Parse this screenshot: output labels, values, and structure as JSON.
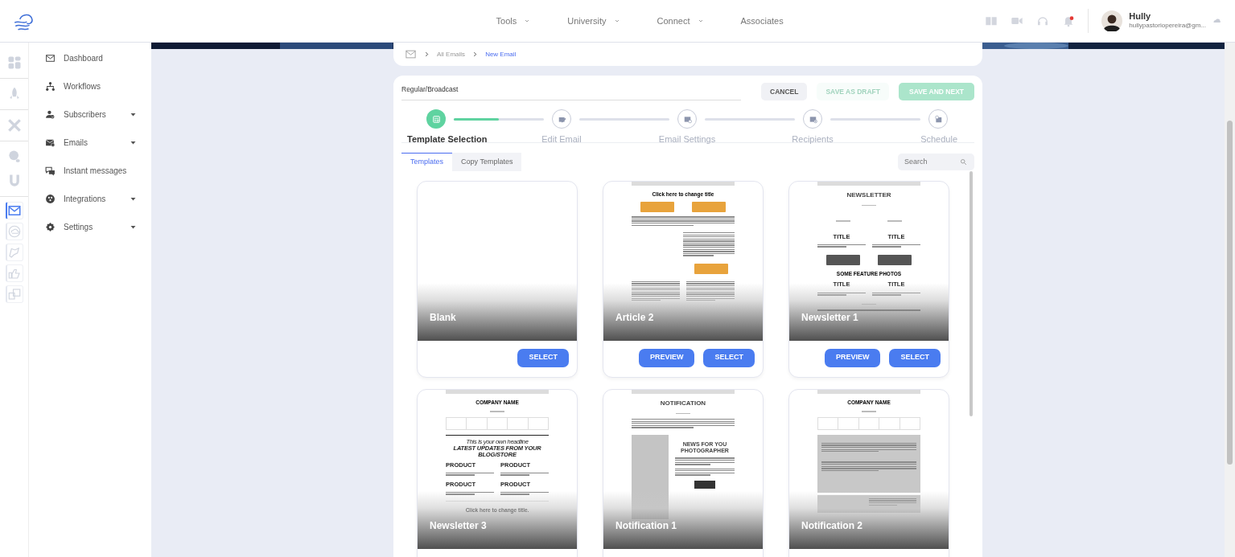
{
  "top_nav": [
    {
      "label": "Tools",
      "dropdown": true
    },
    {
      "label": "University",
      "dropdown": true
    },
    {
      "label": "Connect",
      "dropdown": true
    },
    {
      "label": "Associates",
      "dropdown": false
    }
  ],
  "user": {
    "name": "Hully",
    "email": "hullypastoriopereira@gm...",
    "unread": true
  },
  "rail_groups": [
    {
      "items": [
        {
          "selected": false
        }
      ]
    },
    {
      "items": [
        {
          "selected": false
        }
      ]
    },
    {
      "items": [
        {
          "selected": false
        }
      ]
    },
    {
      "items": [
        {
          "selected": false
        },
        {
          "selected": false
        }
      ]
    },
    {
      "items": [
        {
          "selected": true
        },
        {
          "selected": false
        },
        {
          "selected": false
        },
        {
          "selected": false
        },
        {
          "selected": false
        }
      ]
    }
  ],
  "sidebar": [
    {
      "label": "Dashboard",
      "expandable": false
    },
    {
      "label": "Workflows",
      "expandable": false
    },
    {
      "label": "Subscribers",
      "expandable": true
    },
    {
      "label": "Emails",
      "expandable": true
    },
    {
      "label": "Instant messages",
      "expandable": false
    },
    {
      "label": "Integrations",
      "expandable": true
    },
    {
      "label": "Settings",
      "expandable": true
    }
  ],
  "breadcrumb": [
    {
      "label": "All Emails",
      "current": false
    },
    {
      "label": "New Email",
      "current": true
    }
  ],
  "email_name": {
    "value": "Regular/Broadcast"
  },
  "actions": [
    {
      "label": "CANCEL",
      "kind": "secondary",
      "disabled": false
    },
    {
      "label": "SAVE AS DRAFT",
      "kind": "outline",
      "disabled": true
    },
    {
      "label": "SAVE AND NEXT",
      "kind": "primary",
      "disabled": true
    }
  ],
  "steps": [
    {
      "label": "Template Selection",
      "selected": true,
      "level": 0.5
    },
    {
      "label": "Edit Email",
      "selected": false
    },
    {
      "label": "Email Settings",
      "selected": false
    },
    {
      "label": "Recipients",
      "selected": false
    },
    {
      "label": "Schedule",
      "selected": false
    }
  ],
  "tabs": [
    {
      "label": "Templates",
      "selected": true
    },
    {
      "label": "Copy Templates",
      "selected": false
    }
  ],
  "search": {
    "placeholder": "Search"
  },
  "templates": [
    {
      "name": "Blank",
      "buttons": [
        "SELECT"
      ]
    },
    {
      "name": "Article 2",
      "buttons": [
        "PREVIEW",
        "SELECT"
      ],
      "preview": [
        {
          "kind": "bar"
        },
        {
          "kind": "title",
          "text": "Click here to change title"
        },
        {
          "kind": "button-pair",
          "color": "#e8a33c"
        },
        {
          "kind": "paragraph"
        },
        {
          "kind": "split-paragraph"
        },
        {
          "kind": "button-right",
          "color": "#e8a33c"
        },
        {
          "kind": "two-col-paragraph"
        }
      ]
    },
    {
      "name": "Newsletter 1",
      "buttons": [
        "PREVIEW",
        "SELECT"
      ],
      "preview": [
        {
          "kind": "bar"
        },
        {
          "kind": "masthead",
          "text": "NEWSLETTER"
        },
        {
          "kind": "tagline"
        },
        {
          "kind": "tagline-pair"
        },
        {
          "kind": "label-pair",
          "labels": [
            "TITLE",
            "TITLE"
          ]
        },
        {
          "kind": "button-pair",
          "color": "#555555"
        },
        {
          "kind": "title",
          "text": "SOME FEATURE PHOTOS"
        },
        {
          "kind": "label-pair",
          "labels": [
            "TITLE",
            "TITLE"
          ]
        },
        {
          "kind": "tagline"
        },
        {
          "kind": "dark-block"
        }
      ]
    },
    {
      "name": "Newsletter 3",
      "preview": [
        {
          "kind": "bar"
        },
        {
          "kind": "title",
          "text": "COMPANY NAME"
        },
        {
          "kind": "tagline"
        },
        {
          "kind": "nav-cells"
        },
        {
          "kind": "headline",
          "texts": [
            "This is your own headline",
            "LATEST UPDATES FROM YOUR BLOG/STORE"
          ]
        },
        {
          "kind": "label-pair-left",
          "labels": [
            "PRODUCT",
            "PRODUCT"
          ]
        },
        {
          "kind": "label-pair-left",
          "labels": [
            "PRODUCT",
            "PRODUCT"
          ]
        },
        {
          "kind": "rule"
        },
        {
          "kind": "title",
          "text": "Click here to change title."
        },
        {
          "kind": "tagline"
        }
      ]
    },
    {
      "name": "Notification 1",
      "preview": [
        {
          "kind": "bar"
        },
        {
          "kind": "masthead",
          "text": "NOTIFICATION"
        },
        {
          "kind": "tagline"
        },
        {
          "kind": "paragraph"
        },
        {
          "kind": "feature",
          "text": "NEWS FOR YOU PHOTOGRAPHER"
        }
      ]
    },
    {
      "name": "Notification 2",
      "preview": [
        {
          "kind": "bar"
        },
        {
          "kind": "title",
          "text": "COMPANY NAME"
        },
        {
          "kind": "tagline"
        },
        {
          "kind": "nav-cells"
        },
        {
          "kind": "panel"
        },
        {
          "kind": "panel-split"
        }
      ]
    }
  ]
}
